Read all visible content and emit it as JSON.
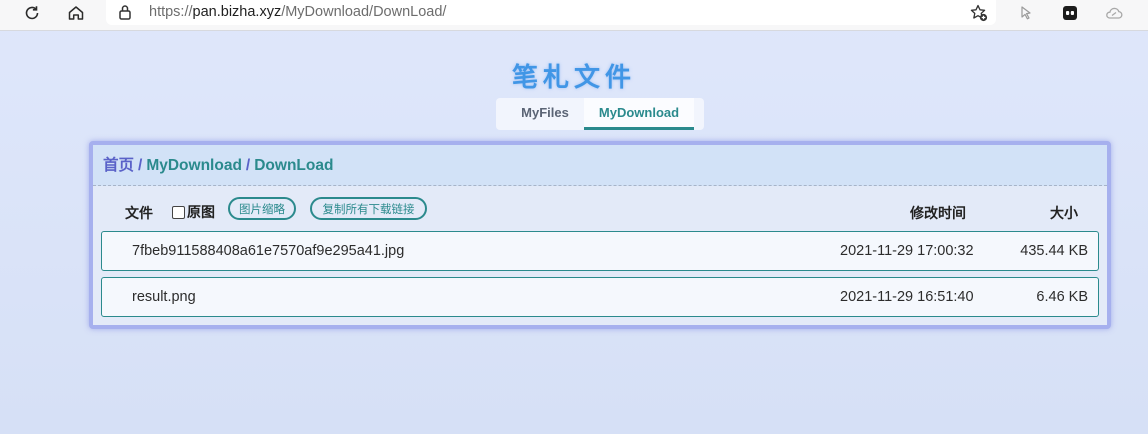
{
  "browser": {
    "url_scheme": "https://",
    "url_host": "pan.bizha.xyz",
    "url_path": "/MyDownload/DownLoad/"
  },
  "page": {
    "title": "笔札文件",
    "tabs": [
      {
        "label": "MyFiles",
        "active": false
      },
      {
        "label": "MyDownload",
        "active": true
      }
    ]
  },
  "breadcrumb": {
    "home": "首页",
    "sep1": "/",
    "item1": "MyDownload",
    "sep2": "/",
    "item2": "DownLoad"
  },
  "header": {
    "file": "文件",
    "original": "原图",
    "thumbnail_button": "图片缩略",
    "copy_links_button": "复制所有下载链接",
    "modified": "修改时间",
    "size": "大小"
  },
  "files": [
    {
      "name": "7fbeb911588408a61e7570af9e295a41.jpg",
      "modified": "2021-11-29 17:00:32",
      "size": "435.44 KB"
    },
    {
      "name": "result.png",
      "modified": "2021-11-29 16:51:40",
      "size": "6.46 KB"
    }
  ],
  "colors": {
    "accent": "#2b8a8d",
    "title": "#4196e6",
    "home_link": "#5a62c8",
    "panel_border": "#a6b0ee"
  }
}
